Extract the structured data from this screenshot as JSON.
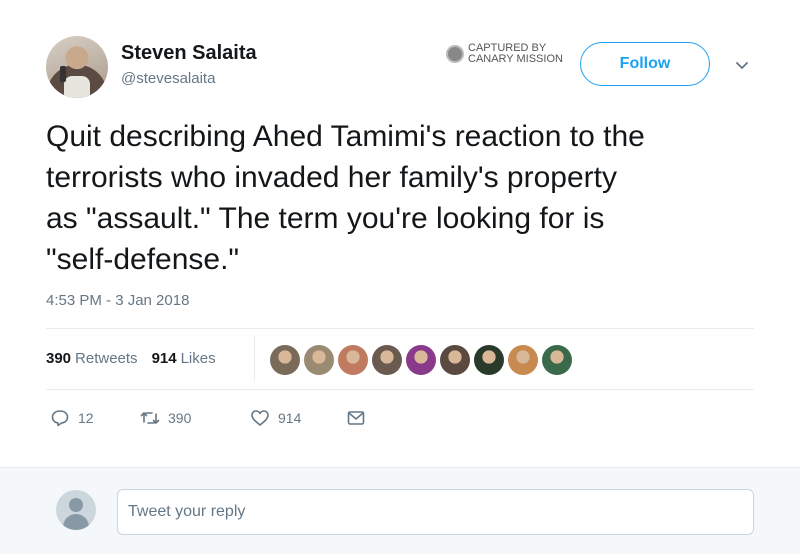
{
  "user": {
    "display_name": "Steven Salaita",
    "handle": "@stevesalaita"
  },
  "watermark": {
    "line1": "CAPTURED BY",
    "line2": "CANARY MISSION"
  },
  "follow_label": "Follow",
  "tweet": {
    "text": "Quit describing Ahed Tamimi's reaction to the\nterrorists who invaded her family's property\nas \"assault.\"  The term you're looking for is\n\"self-defense.\"",
    "timestamp": "4:53 PM - 3 Jan 2018"
  },
  "stats": {
    "retweets_count": "390",
    "retweets_label": "Retweets",
    "likes_count": "914",
    "likes_label": "Likes"
  },
  "liker_avatar_colors": [
    "#7a6a5a",
    "#9a8a72",
    "#c07a60",
    "#6b5a50",
    "#8a3a8a",
    "#5a4a40",
    "#2a3a2a",
    "#c88a50",
    "#3a6a4a"
  ],
  "actions": {
    "reply_count": "12",
    "retweet_count": "390",
    "like_count": "914"
  },
  "reply_box": {
    "placeholder": "Tweet your reply"
  },
  "colors": {
    "accent": "#1da1f2",
    "secondary_text": "#657786"
  }
}
